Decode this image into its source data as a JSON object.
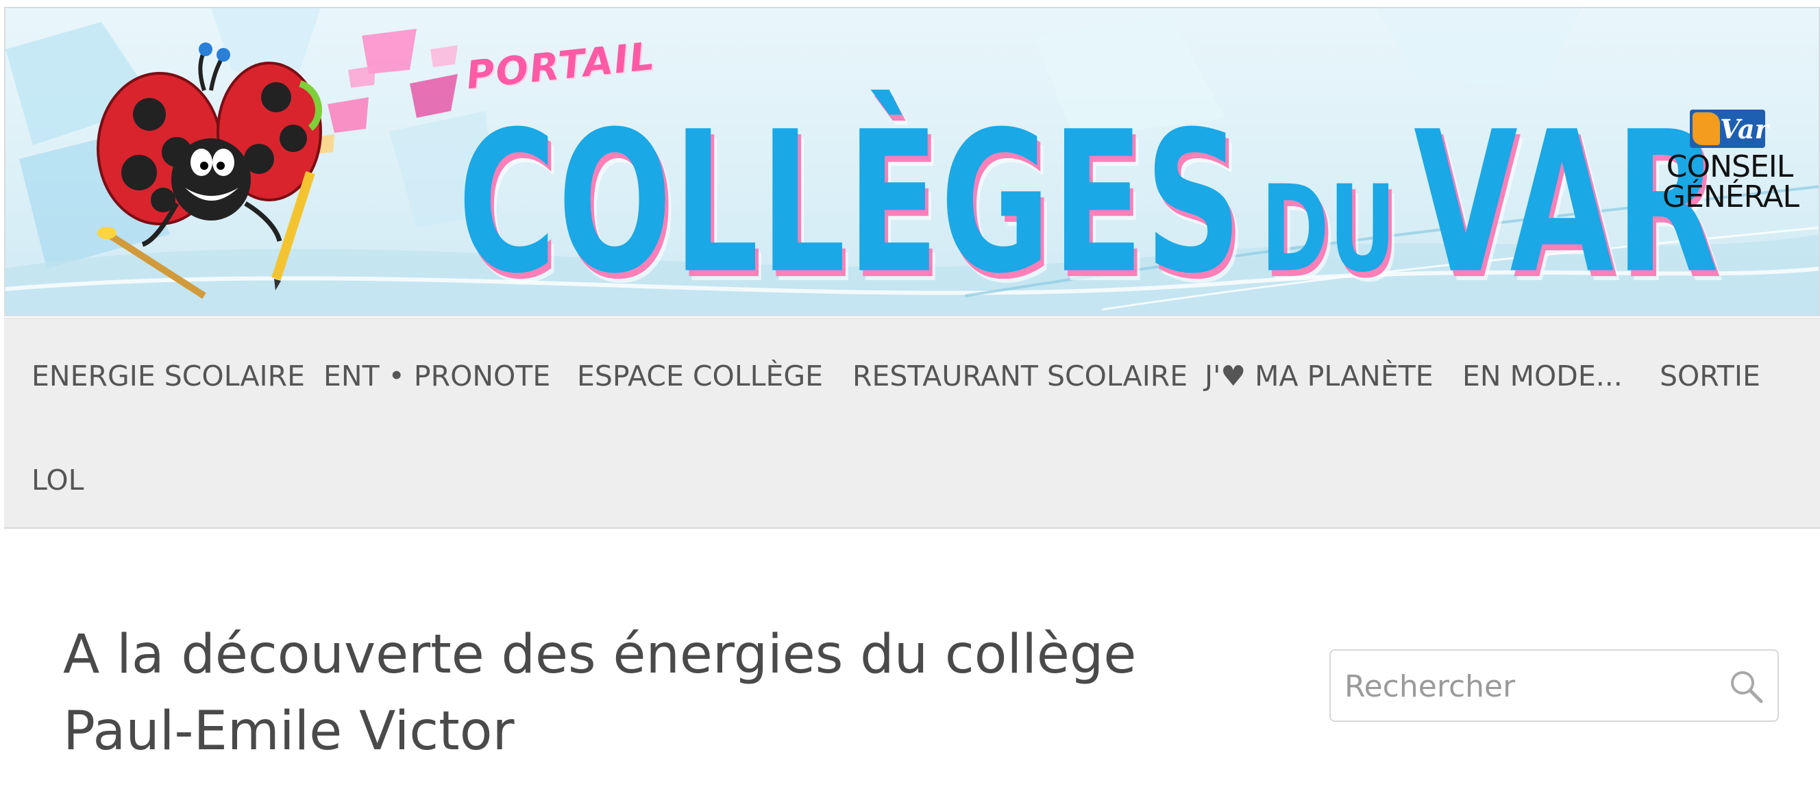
{
  "banner": {
    "portail": "PORTAIL",
    "title_part1": "COLLÈGES",
    "title_part2": "DU",
    "title_part3": "VAR",
    "logo_var": "Var",
    "logo_line1": "CONSEIL",
    "logo_line2": "GÉNÉRAL"
  },
  "nav": {
    "items": [
      {
        "label": "ENERGIE SCOLAIRE"
      },
      {
        "label": "ENT • PRONOTE"
      },
      {
        "label": "ESPACE COLLÈGE"
      },
      {
        "label": "RESTAURANT SCOLAIRE"
      },
      {
        "label": "J'♥ MA PLANÈTE"
      },
      {
        "label": "EN MODE..."
      },
      {
        "label": "SORTIE"
      },
      {
        "label": "LOL"
      }
    ]
  },
  "article": {
    "title": "A la découverte des énergies du collège Paul-Emile Victor"
  },
  "search": {
    "placeholder": "Rechercher",
    "value": ""
  },
  "colors": {
    "title_blue": "#1aa8e6",
    "title_pink_shadow": "#ff7fb8",
    "nav_bg": "#eeeeee",
    "nav_text": "#555555"
  }
}
